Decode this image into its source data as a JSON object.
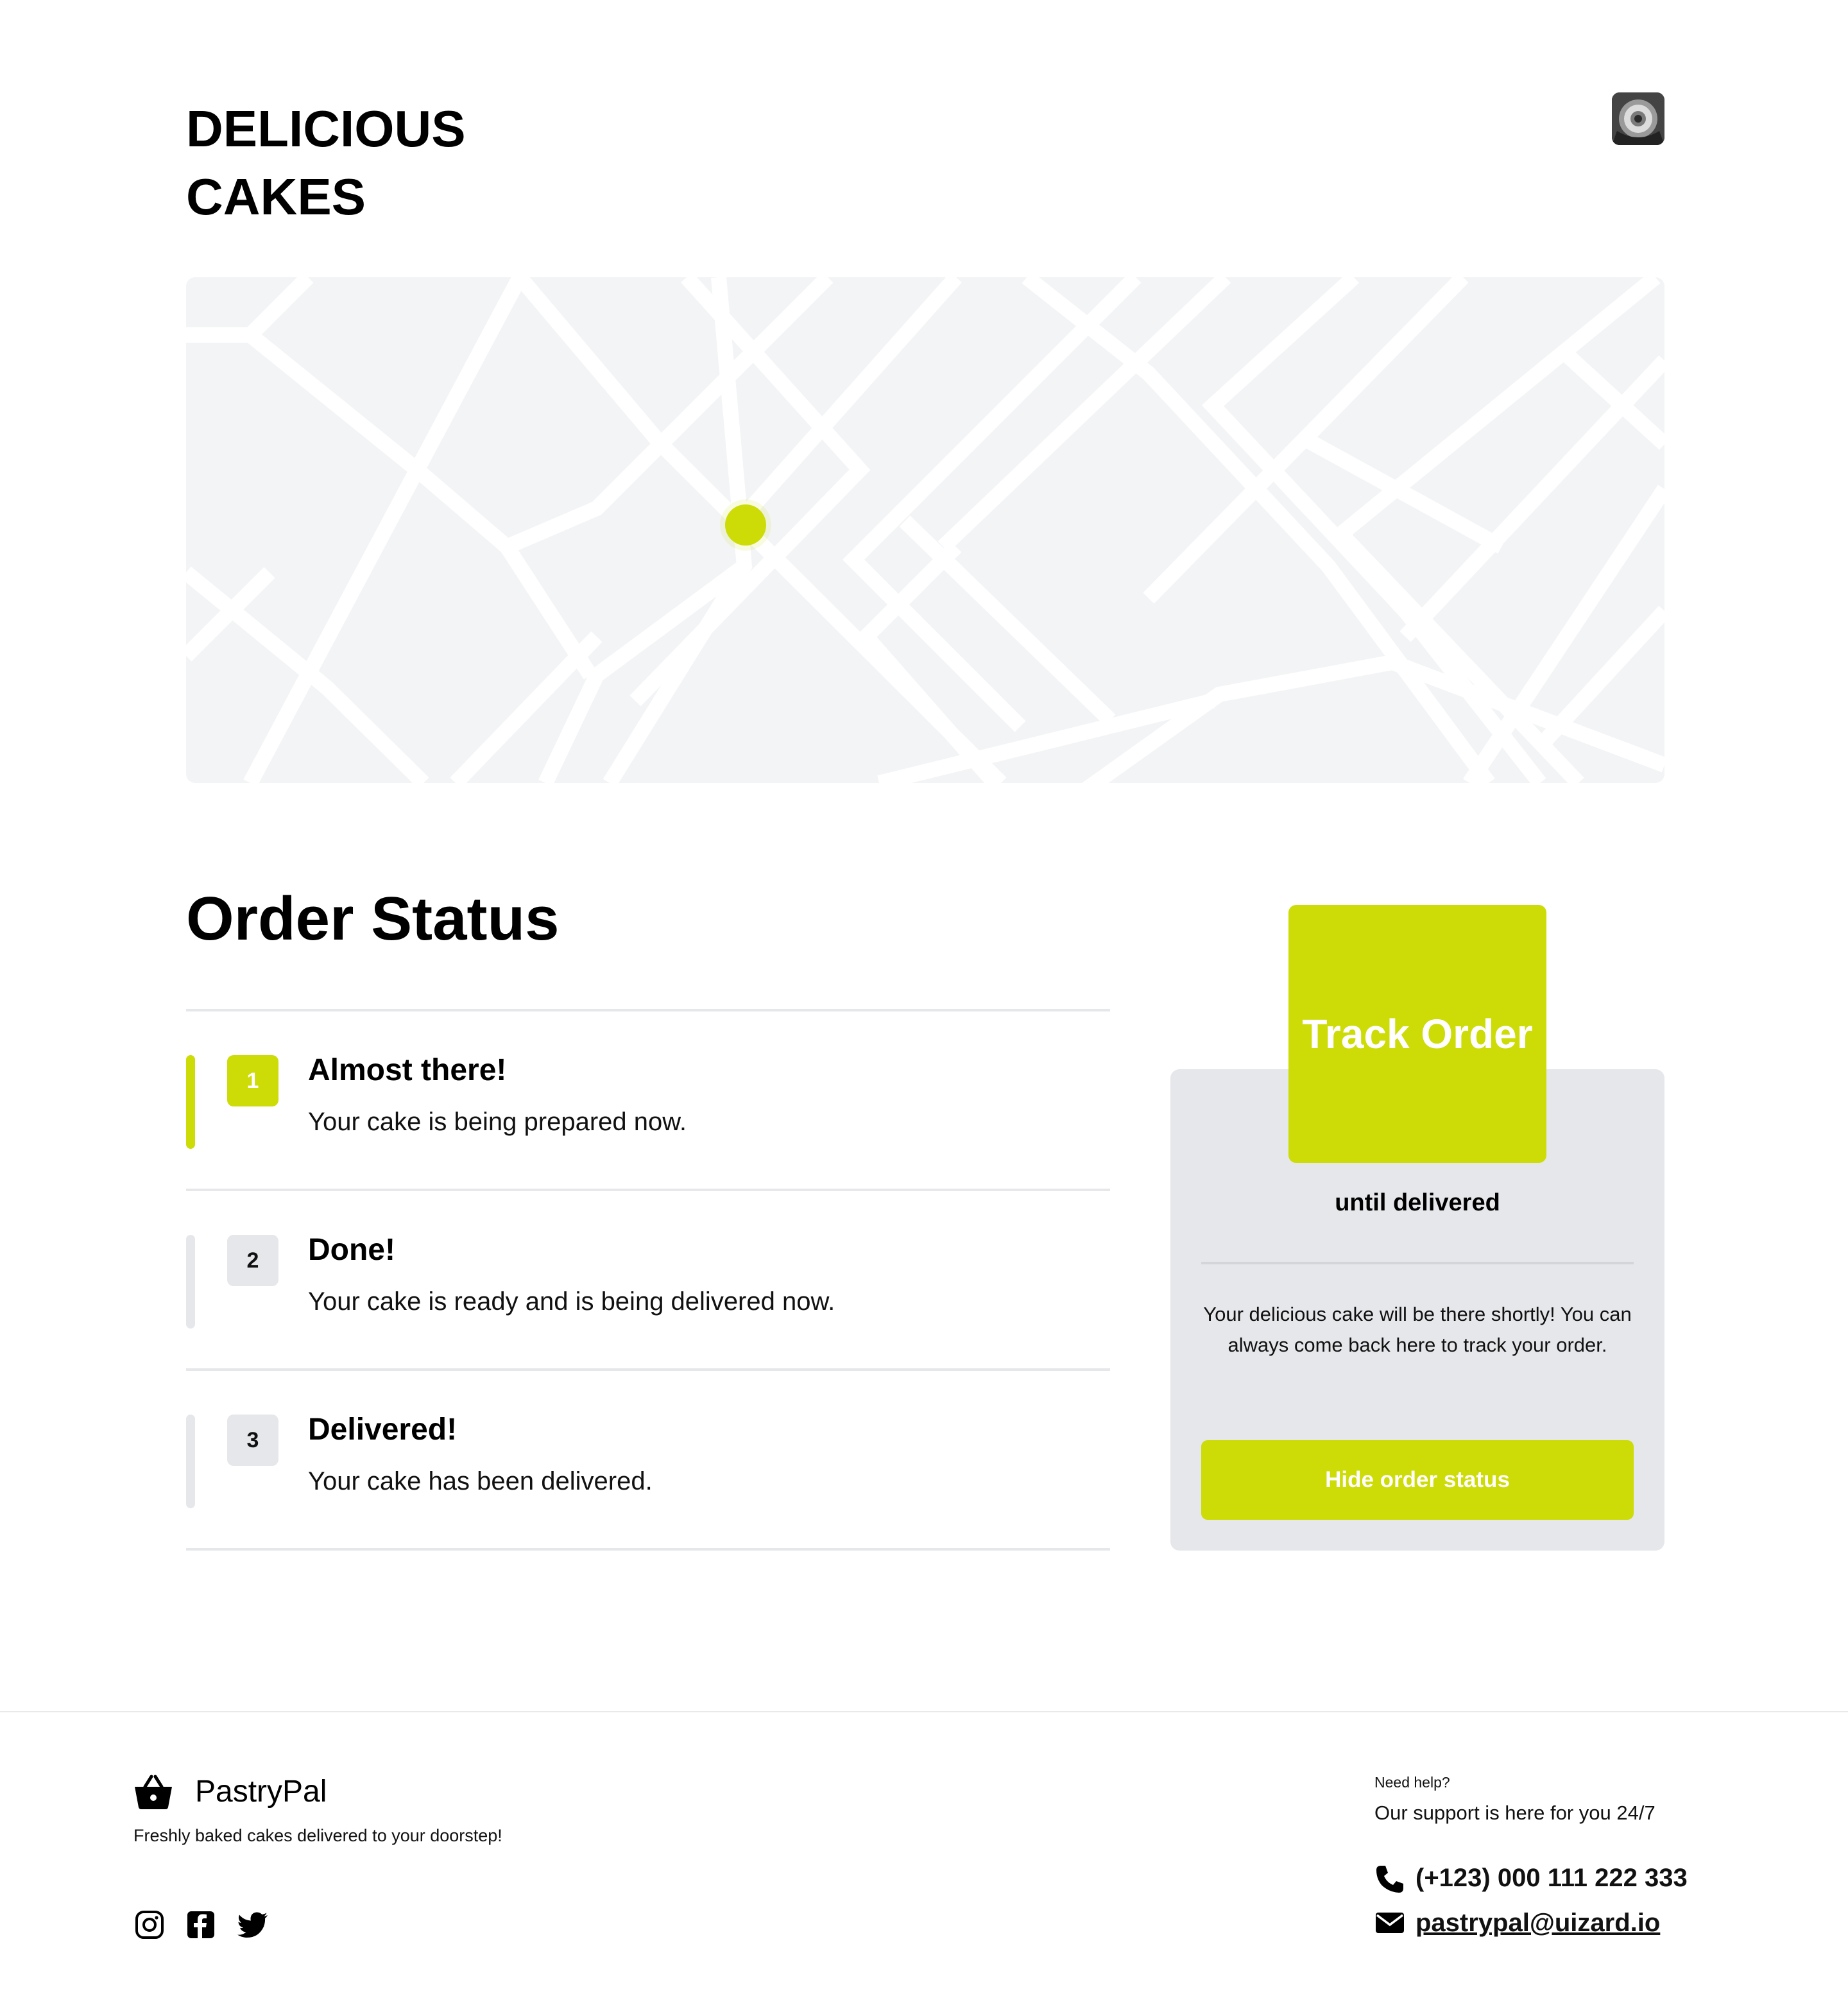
{
  "header": {
    "brand_line1": "DELICIOUS",
    "brand_line2": "CAKES",
    "avatar_icon": "user-avatar-icon"
  },
  "map": {
    "marker_color": "#cddc06",
    "marker_icon": "location-pin-icon"
  },
  "order_status": {
    "title": "Order Status",
    "steps": [
      {
        "number": "1",
        "title": "Almost there!",
        "description": "Your cake is being prepared now.",
        "active": true
      },
      {
        "number": "2",
        "title": "Done!",
        "description": "Your cake is ready and is being delivered now.",
        "active": false
      },
      {
        "number": "3",
        "title": "Delivered!",
        "description": "Your cake has been delivered.",
        "active": false
      }
    ]
  },
  "tracker": {
    "headline": "Track Order",
    "subheadline": "until delivered",
    "message": "Your delicious cake will be there shortly! You can always come back here to track your order.",
    "button_label": "Hide order status"
  },
  "footer": {
    "brand": "PastryPal",
    "brand_icon": "basket-icon",
    "tagline": "Freshly baked cakes delivered to your doorstep!",
    "social_icons": [
      "instagram-icon",
      "facebook-icon",
      "twitter-icon"
    ],
    "help_label": "Need help?",
    "help_text": "Our support is here for you 24/7",
    "phone": "(+123) 000 111 222 333",
    "email": "pastrypal@uizard.io"
  },
  "colors": {
    "accent": "#cddc06",
    "panel": "#e6e7ea",
    "map_bg": "#f3f4f6"
  }
}
